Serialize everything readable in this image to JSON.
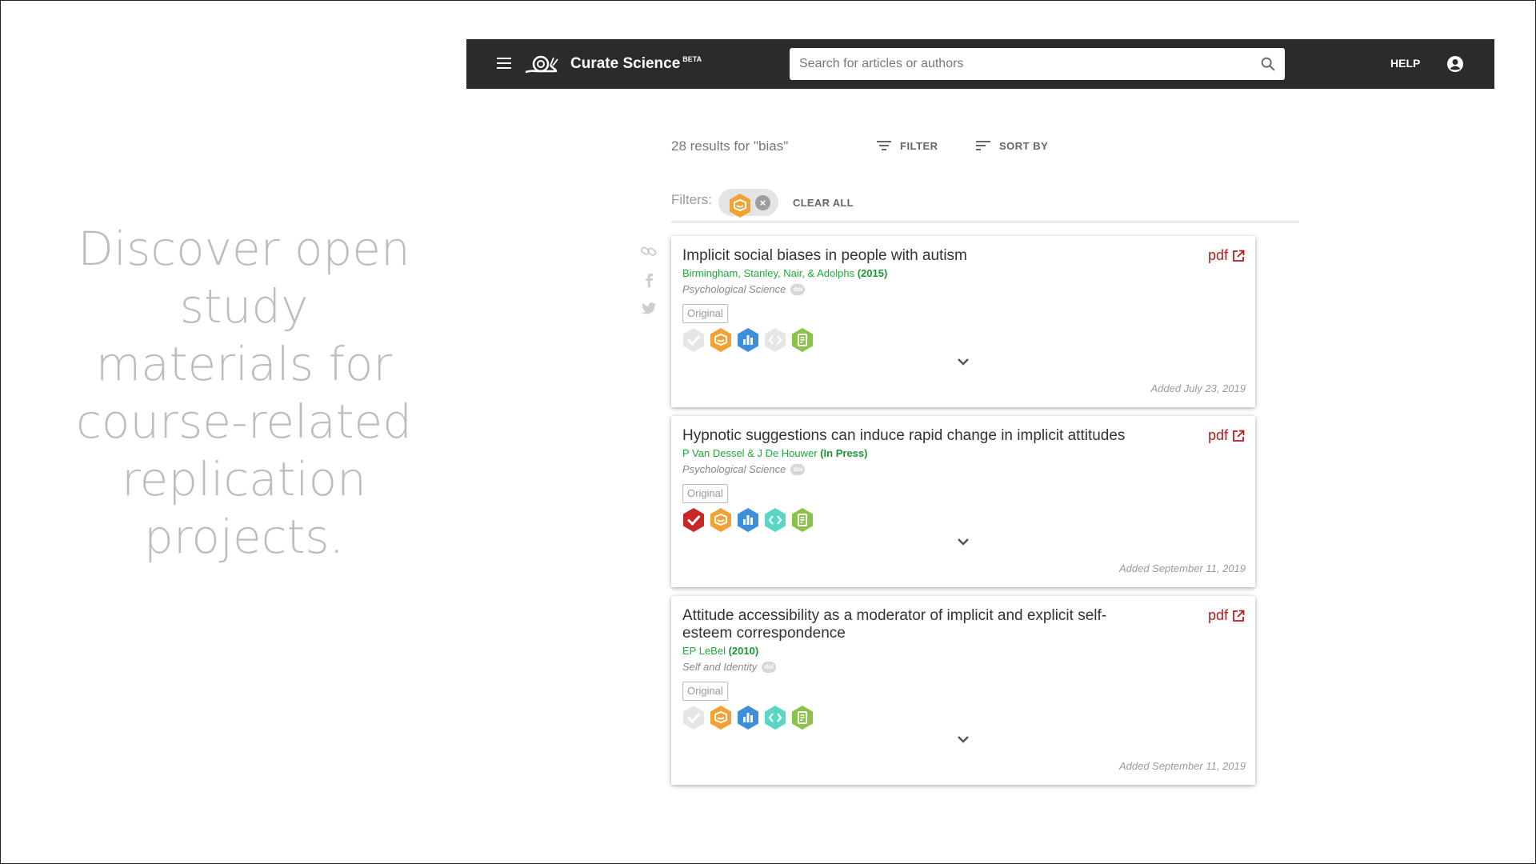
{
  "tagline": "Discover open study materials for course-related replication projects.",
  "appbar": {
    "brand": "Curate Science",
    "brand_badge": "BETA",
    "search_placeholder": "Search for articles or authors",
    "help_label": "HELP",
    "bg_color": "#2b2b2b"
  },
  "results": {
    "count_text": "28 results for \"bias\"",
    "filter_label": "FILTER",
    "sort_label": "SORT BY",
    "filters_label": "Filters:",
    "active_filter_icon": "materials-icon",
    "clear_all_label": "CLEAR ALL"
  },
  "share": [
    "link-icon",
    "facebook-icon",
    "twitter-icon"
  ],
  "badge_colors": {
    "preregistration": "#c62828",
    "materials": "#f2a233",
    "data": "#3d8fdc",
    "code": "#5ad6c4",
    "reporting": "#8bc34a",
    "inactive": "#e6e6e6"
  },
  "cards": [
    {
      "title": "Implicit social biases in people with autism",
      "pdf_label": "pdf",
      "authors": "Birmingham, Stanley, Nair, & Adolphs",
      "year": "(2015)",
      "journal": "Psychological Science",
      "doi_label": "doi",
      "tag": "Original",
      "badges": {
        "preregistration": false,
        "materials": true,
        "data": true,
        "code": false,
        "reporting": true
      },
      "added": "Added July 23, 2019"
    },
    {
      "title": "Hypnotic suggestions can induce rapid change in implicit attitudes",
      "pdf_label": "pdf",
      "authors": "P Van Dessel & J De Houwer",
      "year": "(In Press)",
      "journal": "Psychological Science",
      "doi_label": "doi",
      "tag": "Original",
      "badges": {
        "preregistration": true,
        "materials": true,
        "data": true,
        "code": true,
        "reporting": true
      },
      "added": "Added September 11, 2019"
    },
    {
      "title": "Attitude accessibility as a moderator of implicit and explicit self-esteem correspondence",
      "pdf_label": "pdf",
      "authors": "EP LeBel",
      "year": "(2010)",
      "journal": "Self and Identity",
      "doi_label": "doi",
      "tag": "Original",
      "badges": {
        "preregistration": false,
        "materials": true,
        "data": true,
        "code": true,
        "reporting": true
      },
      "added": "Added September 11, 2019"
    }
  ]
}
